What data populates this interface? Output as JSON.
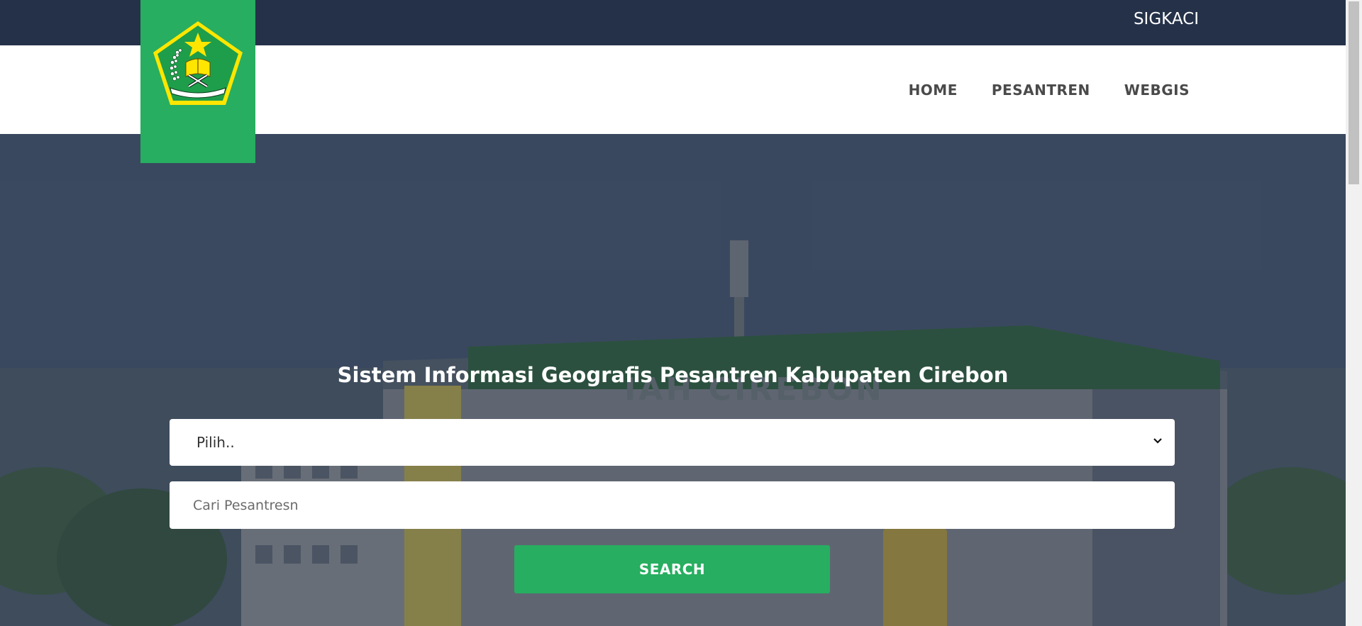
{
  "header": {
    "brand": "SIGKACI",
    "logo": "kemenag-logo-icon",
    "nav": [
      {
        "label": "HOME"
      },
      {
        "label": "PESANTREN"
      },
      {
        "label": "WEBGIS"
      }
    ]
  },
  "hero": {
    "title": "Sistem Informasi Geografis Pesantren Kabupaten Cirebon",
    "background_text": "IAH CIREBON",
    "select": {
      "value": "Pilih.."
    },
    "search": {
      "placeholder": "Cari Pesantresn",
      "value": ""
    },
    "search_button": "SEARCH"
  },
  "colors": {
    "topbar": "#243149",
    "accent_green": "#27ae60",
    "nav_text": "#4a4a4a"
  }
}
